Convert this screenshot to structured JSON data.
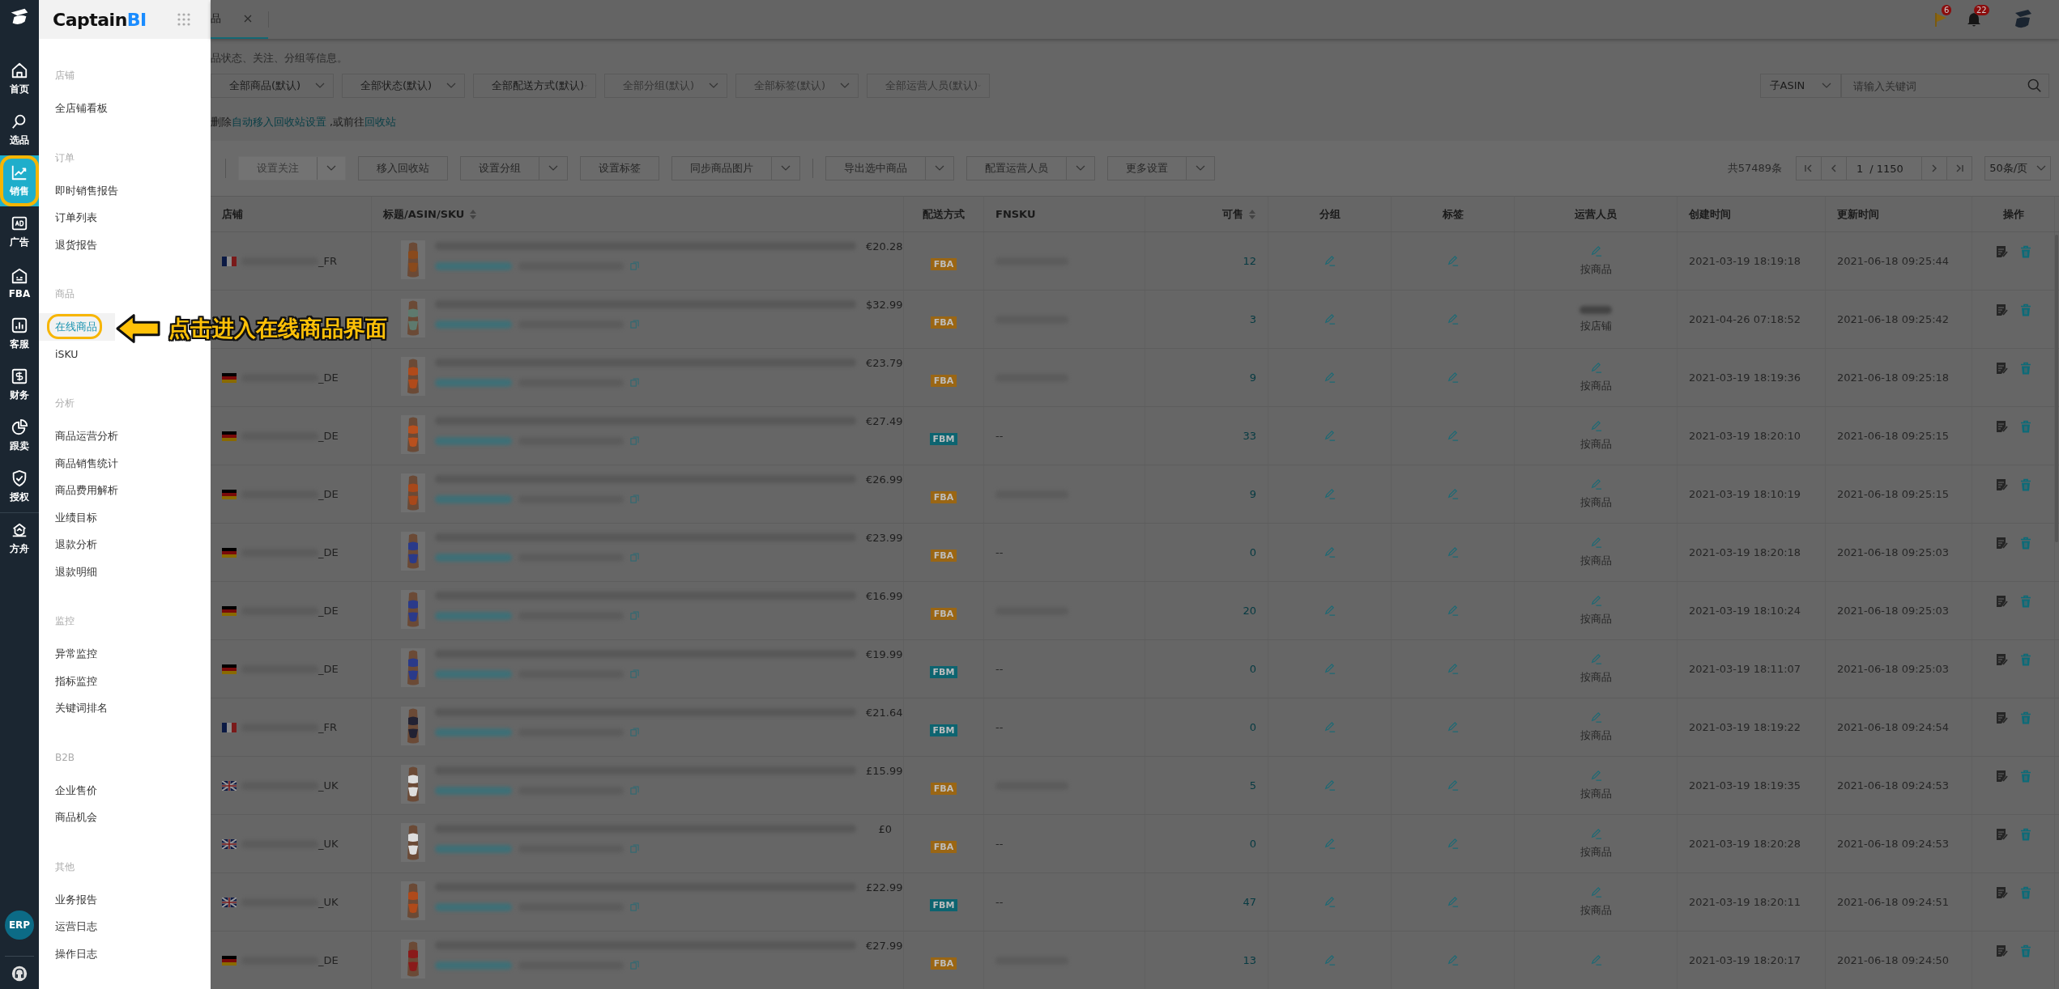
{
  "rail": {
    "items": [
      {
        "label": "首页",
        "kind": "home",
        "selected": false
      },
      {
        "label": "选品",
        "kind": "search",
        "selected": false
      },
      {
        "label": "销售",
        "kind": "chart",
        "selected": true
      },
      {
        "label": "广告",
        "kind": "ad",
        "selected": false
      },
      {
        "label": "FBA",
        "kind": "fba",
        "selected": false
      },
      {
        "label": "客服",
        "kind": "service",
        "selected": false
      },
      {
        "label": "财务",
        "kind": "finance",
        "selected": false
      },
      {
        "label": "跟卖",
        "kind": "pie",
        "selected": false
      },
      {
        "label": "授权",
        "kind": "shield",
        "selected": false
      },
      {
        "label": "方舟",
        "kind": "ark",
        "selected": false
      }
    ],
    "erp": "ERP"
  },
  "menu": {
    "logo": {
      "text": "Captain",
      "accent": "BI"
    },
    "sections": [
      {
        "title": "店铺",
        "items": [
          {
            "label": "全店铺看板",
            "selected": false
          }
        ]
      },
      {
        "title": "订单",
        "items": [
          {
            "label": "即时销售报告",
            "selected": false
          },
          {
            "label": "订单列表",
            "selected": false
          },
          {
            "label": "退货报告",
            "selected": false
          }
        ]
      },
      {
        "title": "商品",
        "items": [
          {
            "label": "在线商品",
            "selected": true
          },
          {
            "label": "iSKU",
            "selected": false
          }
        ]
      },
      {
        "title": "分析",
        "items": [
          {
            "label": "商品运营分析",
            "selected": false
          },
          {
            "label": "商品销售统计",
            "selected": false
          },
          {
            "label": "商品费用解析",
            "selected": false
          },
          {
            "label": "业绩目标",
            "selected": false
          },
          {
            "label": "退款分析",
            "selected": false
          },
          {
            "label": "退款明细",
            "selected": false
          }
        ]
      },
      {
        "title": "监控",
        "items": [
          {
            "label": "异常监控",
            "selected": false
          },
          {
            "label": "指标监控",
            "selected": false
          },
          {
            "label": "关键词排名",
            "selected": false
          }
        ]
      },
      {
        "title": "B2B",
        "items": [
          {
            "label": "企业售价",
            "selected": false
          },
          {
            "label": "商品机会",
            "selected": false
          }
        ]
      },
      {
        "title": "其他",
        "items": [
          {
            "label": "业务报告",
            "selected": false
          },
          {
            "label": "运营日志",
            "selected": false
          },
          {
            "label": "操作日志",
            "selected": false
          }
        ]
      }
    ]
  },
  "annotation": {
    "text": "点击进入在线商品界面"
  },
  "tab": {
    "label": "品"
  },
  "header": {
    "flag_count": "6",
    "bell_count": "22"
  },
  "info": "品状态、关注、分组等信息。",
  "filters": [
    {
      "label": "全部商品(默认)",
      "disabled": false
    },
    {
      "label": "全部状态(默认)",
      "disabled": false
    },
    {
      "label": "全部配送方式(默认)",
      "disabled": false
    },
    {
      "label": "全部分组(默认)",
      "disabled": true
    },
    {
      "label": "全部标签(默认)",
      "disabled": true
    },
    {
      "label": "全部运营人员(默认)",
      "disabled": true
    }
  ],
  "search": {
    "scope": "子ASIN",
    "placeholder": "请输入关键词"
  },
  "notice": [
    {
      "text": "删除",
      "link": false
    },
    {
      "text": "自动移入回收站设置",
      "link": true
    },
    {
      "text": " ,或前往",
      "link": false
    },
    {
      "text": "回收站",
      "link": true
    }
  ],
  "toolbar": {
    "buttons": [
      {
        "kind": "divider"
      },
      {
        "kind": "button",
        "label": "设置关注",
        "split": true,
        "disabled": true
      },
      {
        "kind": "button",
        "label": "移入回收站",
        "split": false,
        "disabled": false
      },
      {
        "kind": "button",
        "label": "设置分组",
        "split": true,
        "disabled": false
      },
      {
        "kind": "button",
        "label": "设置标签",
        "split": false,
        "disabled": false
      },
      {
        "kind": "button",
        "label": "同步商品图片",
        "split": true,
        "disabled": false
      },
      {
        "kind": "divider"
      },
      {
        "kind": "button",
        "label": "导出选中商品",
        "split": true,
        "disabled": false
      },
      {
        "kind": "button",
        "label": "配置运营人员",
        "split": true,
        "disabled": false
      },
      {
        "kind": "button",
        "label": "更多设置",
        "split": true,
        "disabled": false
      }
    ],
    "total": "共57489条",
    "page": "1",
    "pages": "/ 1150",
    "page_size": "50条/页"
  },
  "table": {
    "columns": [
      {
        "label": "店铺",
        "sortable": false
      },
      {
        "label": "标题/ASIN/SKU",
        "sortable": true
      },
      {
        "label": "配送方式",
        "sortable": false
      },
      {
        "label": "FNSKU",
        "sortable": false
      },
      {
        "label": "可售",
        "sortable": true
      },
      {
        "label": "分组",
        "sortable": false
      },
      {
        "label": "标签",
        "sortable": false
      },
      {
        "label": "运营人员",
        "sortable": false
      },
      {
        "label": "创建时间",
        "sortable": false
      },
      {
        "label": "更新时间",
        "sortable": false
      },
      {
        "label": "操作",
        "sortable": false
      }
    ],
    "rows": [
      {
        "store": {
          "kind": "fr",
          "suffix": "_FR"
        },
        "price": "€20.28",
        "fulfillment": {
          "text": "FBA",
          "color": "#9a6614"
        },
        "sellable": "12",
        "operator": "按商品",
        "created": "2021-03-19 18:19:18",
        "updated": "2021-06-18 09:25:44"
      },
      {
        "price": "$32.99",
        "fulfillment": {
          "text": "FBA",
          "color": "#9a6614"
        },
        "sellable": "3",
        "operator": "按店铺",
        "operator_blurred": true,
        "created": "2021-04-26 07:18:52",
        "updated": "2021-06-18 09:25:42"
      },
      {
        "store": {
          "kind": "de",
          "suffix": "_DE"
        },
        "price": "€23.79",
        "fulfillment": {
          "text": "FBA",
          "color": "#9a6614"
        },
        "sellable": "9",
        "operator": "按商品",
        "created": "2021-03-19 18:19:36",
        "updated": "2021-06-18 09:25:18"
      },
      {
        "store": {
          "kind": "de",
          "suffix": "_DE"
        },
        "price": "€27.49",
        "fulfillment": {
          "text": "FBM",
          "color": "#0d6470"
        },
        "fnsku": "--",
        "sellable": "33",
        "operator": "按商品",
        "created": "2021-03-19 18:20:10",
        "updated": "2021-06-18 09:25:15"
      },
      {
        "store": {
          "kind": "de",
          "suffix": "_DE"
        },
        "price": "€26.99",
        "fulfillment": {
          "text": "FBA",
          "color": "#9a6614"
        },
        "sellable": "9",
        "operator": "按商品",
        "created": "2021-03-19 18:10:19",
        "updated": "2021-06-18 09:25:15"
      },
      {
        "store": {
          "kind": "de",
          "suffix": "_DE"
        },
        "price": "€23.99",
        "fulfillment": {
          "text": "FBA",
          "color": "#9a6614"
        },
        "fnsku": "--",
        "sellable": "0",
        "operator": "按商品",
        "created": "2021-03-19 18:20:18",
        "updated": "2021-06-18 09:25:03"
      },
      {
        "store": {
          "kind": "de",
          "suffix": "_DE"
        },
        "price": "€16.99",
        "fulfillment": {
          "text": "FBA",
          "color": "#9a6614"
        },
        "sellable": "20",
        "operator": "按商品",
        "created": "2021-03-19 18:10:24",
        "updated": "2021-06-18 09:25:03"
      },
      {
        "store": {
          "kind": "de",
          "suffix": "_DE"
        },
        "price": "€19.99",
        "fulfillment": {
          "text": "FBM",
          "color": "#0d6470"
        },
        "fnsku": "--",
        "sellable": "0",
        "operator": "按商品",
        "created": "2021-03-19 18:11:07",
        "updated": "2021-06-18 09:25:03"
      },
      {
        "store": {
          "kind": "fr",
          "suffix": "_FR"
        },
        "price": "€21.64",
        "fulfillment": {
          "text": "FBM",
          "color": "#0d6470"
        },
        "fnsku": "--",
        "sellable": "0",
        "operator": "按商品",
        "created": "2021-03-19 18:19:22",
        "updated": "2021-06-18 09:24:54"
      },
      {
        "store": {
          "kind": "uk",
          "suffix": "_UK"
        },
        "price": "£15.99",
        "fulfillment": {
          "text": "FBA",
          "color": "#9a6614"
        },
        "sellable": "5",
        "operator": "按商品",
        "created": "2021-03-19 18:19:35",
        "updated": "2021-06-18 09:24:53"
      },
      {
        "store": {
          "kind": "uk",
          "suffix": "_UK"
        },
        "price": "£0",
        "fulfillment": {
          "text": "FBA",
          "color": "#9a6614"
        },
        "fnsku": "--",
        "sellable": "0",
        "operator": "按商品",
        "created": "2021-03-19 18:20:28",
        "updated": "2021-06-18 09:24:53"
      },
      {
        "store": {
          "kind": "uk",
          "suffix": "_UK"
        },
        "price": "£22.99",
        "fulfillment": {
          "text": "FBM",
          "color": "#0d6470"
        },
        "fnsku": "--",
        "sellable": "47",
        "operator": "按商品",
        "created": "2021-03-19 18:20:11",
        "updated": "2021-06-18 09:24:51"
      },
      {
        "store": {
          "kind": "de",
          "suffix": "_DE"
        },
        "price": "€27.99",
        "fulfillment": {
          "text": "FBA",
          "color": "#9a6614"
        },
        "sellable": "13",
        "created": "2021-03-19 18:20:17",
        "updated": "2021-06-18 09:24:50"
      }
    ]
  }
}
